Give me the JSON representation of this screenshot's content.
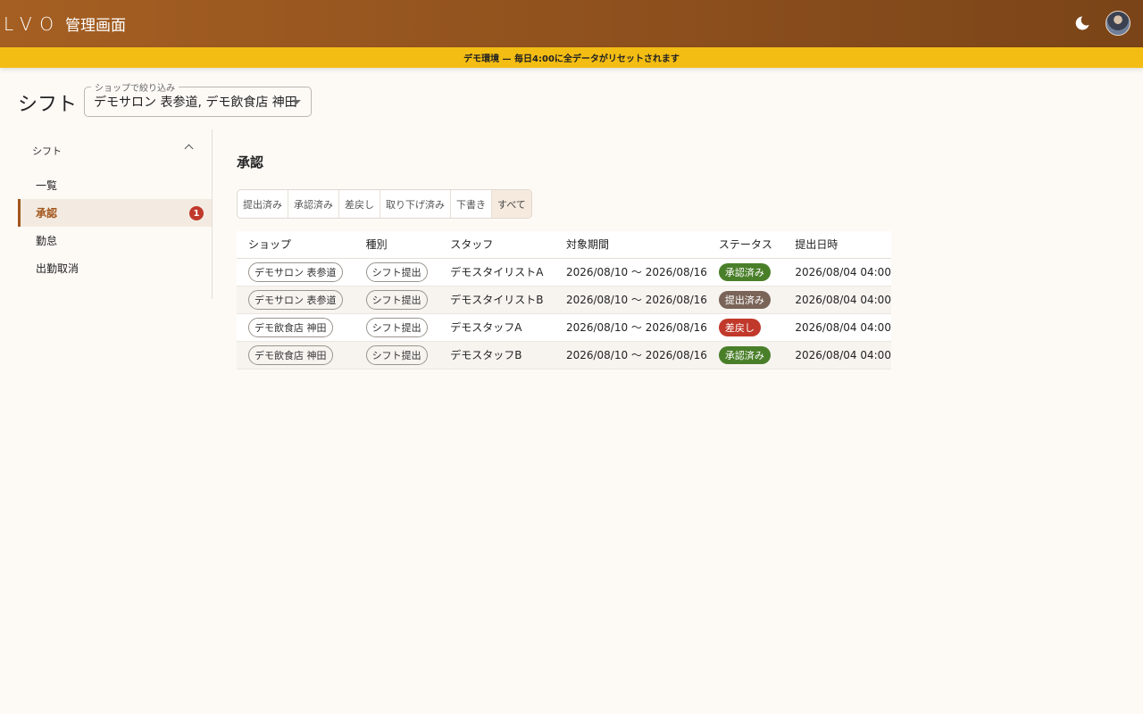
{
  "header": {
    "logo": "LVO",
    "title": "管理画面",
    "theme_icon": "moon-icon",
    "avatar_icon": "user-avatar"
  },
  "banner": {
    "text": "デモ環境 — 毎日4:00に全データがリセットされます"
  },
  "page": {
    "title": "シフト",
    "shop_filter": {
      "label": "ショップで絞り込み",
      "value": "デモサロン 表参道, デモ飲食店 神田"
    }
  },
  "sidebar": {
    "group_label": "シフト",
    "items": [
      {
        "label": "一覧",
        "badge": ""
      },
      {
        "label": "承認",
        "badge": "1"
      },
      {
        "label": "勤怠",
        "badge": ""
      },
      {
        "label": "出勤取消",
        "badge": ""
      }
    ]
  },
  "main": {
    "section_title": "承認",
    "tabs": [
      "提出済み",
      "承認済み",
      "差戻し",
      "取り下げ済み",
      "下書き",
      "すべて"
    ],
    "active_tab": "すべて",
    "table": {
      "headers": [
        "ショップ",
        "種別",
        "スタッフ",
        "対象期間",
        "ステータス",
        "提出日時"
      ],
      "rows": [
        {
          "shop": "デモサロン 表参道",
          "type": "シフト提出",
          "staff": "デモスタイリストA",
          "period": "2026/08/10 〜 2026/08/16",
          "status": "承認済み",
          "submitted": "2026/08/04 04:00"
        },
        {
          "shop": "デモサロン 表参道",
          "type": "シフト提出",
          "staff": "デモスタイリストB",
          "period": "2026/08/10 〜 2026/08/16",
          "status": "提出済み",
          "submitted": "2026/08/04 04:00"
        },
        {
          "shop": "デモ飲食店 神田",
          "type": "シフト提出",
          "staff": "デモスタッフA",
          "period": "2026/08/10 〜 2026/08/16",
          "status": "差戻し",
          "submitted": "2026/08/04 04:00"
        },
        {
          "shop": "デモ飲食店 神田",
          "type": "シフト提出",
          "staff": "デモスタッフB",
          "period": "2026/08/10 〜 2026/08/16",
          "status": "承認済み",
          "submitted": "2026/08/04 04:00"
        }
      ]
    }
  },
  "colors": {
    "header_start": "#a55f22",
    "header_end": "#7a4418",
    "banner": "#f3bd14",
    "accent": "#a3561d",
    "status_approved": "#4a7f2a",
    "status_submitted": "#7a6458",
    "status_rejected": "#c0392b",
    "badge": "#c0392b"
  }
}
